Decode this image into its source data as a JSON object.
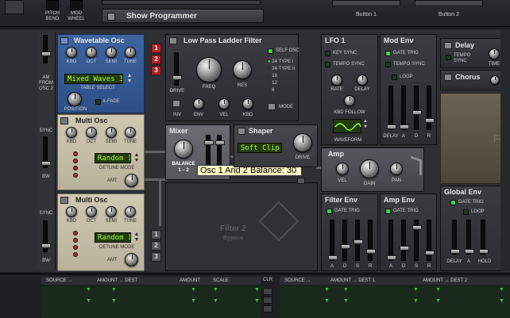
{
  "top": {
    "pitch_bend": "PITCH\nBEND",
    "mod_wheel": "MOD\nWHEEL",
    "show_programmer": "Show Programmer",
    "button1": "Button 1",
    "button2": "Button 2"
  },
  "left": {
    "am_from_osc2": "AM\nFROM\nOSC 2",
    "sync": "SYNC",
    "bw": "BW",
    "sync2": "SYNC",
    "bw2": "BW"
  },
  "wavetable": {
    "title": "Wavetable Osc",
    "knobs": [
      "KBD",
      "OCT",
      "SEMI",
      "TUNE"
    ],
    "display": "Mixed Waves 3",
    "table_select": "TABLE SELECT",
    "position": "POSITION",
    "xfade": "X-FADE"
  },
  "multi1": {
    "title": "Multi Osc",
    "knobs": [
      "KBD",
      "OCT",
      "SEMI",
      "TUNE"
    ],
    "display": "Random 1",
    "detune_mode": "DETUNE MODE",
    "amt": "AMT"
  },
  "multi2": {
    "title": "Multi Osc",
    "knobs": [
      "KBD",
      "OCT",
      "SEMI",
      "TUNE"
    ],
    "display": "Random 1",
    "detune_mode": "DETUNE MODE",
    "amt": "AMT"
  },
  "filter": {
    "title": "Low Pass Ladder Filter",
    "self_osc": "SELF OSC",
    "types": [
      "24 TYPE I",
      "24 TYPE II",
      "18",
      "12",
      "6"
    ],
    "freq": "FREQ",
    "res": "RES",
    "drive": "DRIVE",
    "inv": "INV",
    "env": "ENV",
    "vel": "VEL",
    "kbd": "KBD",
    "mode": "MODE",
    "routing": [
      "1",
      "2",
      "3"
    ]
  },
  "mixer": {
    "title": "Mixer",
    "balance": "BALANCE",
    "range": "1 – 2",
    "tooltip": "Osc 1 And 2 Balance: 30"
  },
  "shaper": {
    "title": "Shaper",
    "display": "Soft Clip",
    "drive": "DRIVE"
  },
  "filter2": {
    "title": "Filter 2",
    "sub": "Bypass",
    "routing": [
      "1",
      "2",
      "3"
    ]
  },
  "lfo": {
    "title": "LFO 1",
    "key_sync": "KEY SYNC",
    "tempo_sync": "TEMPO SYNC",
    "rate": "RATE",
    "delay": "DELAY",
    "kbd_follow": "KBD FOLLOW",
    "waveform": "WAVEFORM"
  },
  "modenv": {
    "title": "Mod Env",
    "gate_trig": "GATE TRIG",
    "tempo_sync": "TEMPO SYNC",
    "loop": "LOOP",
    "sliders": [
      "DELAY",
      "A",
      "D",
      "R"
    ]
  },
  "amp": {
    "title": "Amp",
    "vel": "VEL",
    "gain": "GAIN",
    "pan": "PAN"
  },
  "filterenv": {
    "title": "Filter Env",
    "gate_trig": "GATE TRIG",
    "sliders": [
      "A",
      "D",
      "S",
      "R"
    ]
  },
  "ampenv": {
    "title": "Amp Env",
    "gate_trig": "GATE TRIG",
    "sliders": [
      "A",
      "D",
      "S",
      "R"
    ]
  },
  "delay": {
    "title": "Delay",
    "tempo_sync": "TEMPO\nSYNC",
    "time": "TIME"
  },
  "chorus": {
    "title": "Chorus"
  },
  "global_env": {
    "title": "Global Env",
    "gate_trig": "GATE TRIG",
    "loop": "LOOP",
    "sliders": [
      "DELAY",
      "A",
      "HOLD"
    ]
  },
  "bus": {
    "left_headers": [
      "SOURCE →",
      "AMOUNT → DEST",
      "AMOUNT",
      "SCALE"
    ],
    "clr": "CLR",
    "right_headers": [
      "SOURCE →",
      "AMOUNT → DEST 1",
      "AMOUNT → DEST 2"
    ]
  },
  "colors": {
    "accent_green": "#3fd14a",
    "route_red": "#b3232a",
    "osc_blue": "#3e64a0",
    "osc_cream": "#cfc8b2"
  }
}
